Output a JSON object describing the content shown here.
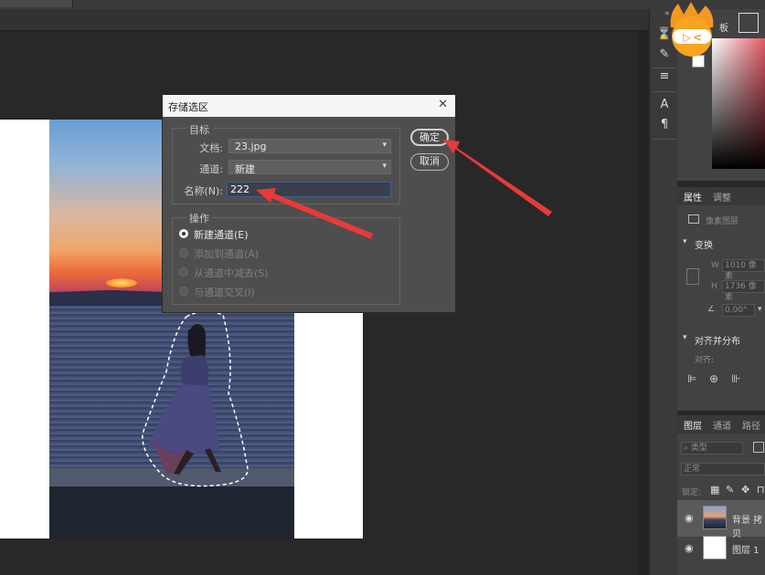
{
  "dialog": {
    "title": "存储选区",
    "target_group_label": "目标",
    "document_label": "文档:",
    "document_value": "23.jpg",
    "channel_label": "通道:",
    "channel_value": "新建",
    "name_label": "名称(N):",
    "name_value": "222",
    "ok_label": "确定",
    "cancel_label": "取消",
    "operation_group_label": "操作",
    "operations": [
      {
        "label": "新建通道(E)",
        "selected": true,
        "enabled": true
      },
      {
        "label": "添加到通道(A)",
        "selected": false,
        "enabled": false
      },
      {
        "label": "从通道中减去(S)",
        "selected": false,
        "enabled": false
      },
      {
        "label": "与通道交叉(I)",
        "selected": false,
        "enabled": false
      }
    ],
    "close_glyph": "✕"
  },
  "right_panel": {
    "color_tab": "板",
    "properties_tab": "属性",
    "adjust_tab": "调整",
    "pixel_layer_label": "像素图层",
    "transform_section": "变换",
    "w_label": "W",
    "w_value": "1010 像素",
    "h_label": "H",
    "h_value": "1736 像素",
    "angle_value": "0.00°",
    "align_section": "对齐并分布",
    "align_label": "对齐:",
    "layers_tab": "图层",
    "channels_tab": "通道",
    "paths_tab": "路径",
    "filter_placeholder": "类型",
    "blend_mode": "正常",
    "lock_label": "锁定:",
    "layers": [
      {
        "name": "背景 拷贝"
      },
      {
        "name": "图层 1"
      }
    ]
  },
  "toolbar_icons": [
    "history-icon",
    "brush-settings-icon",
    "adjust-sliders-icon",
    "character-icon",
    "paragraph-icon"
  ],
  "colors": {
    "dialog_bg": "#4e4e4e",
    "annotation_arrow": "#e83a3a",
    "selection_ants": "#ffffff",
    "input_focus_border": "#3e5f95"
  }
}
